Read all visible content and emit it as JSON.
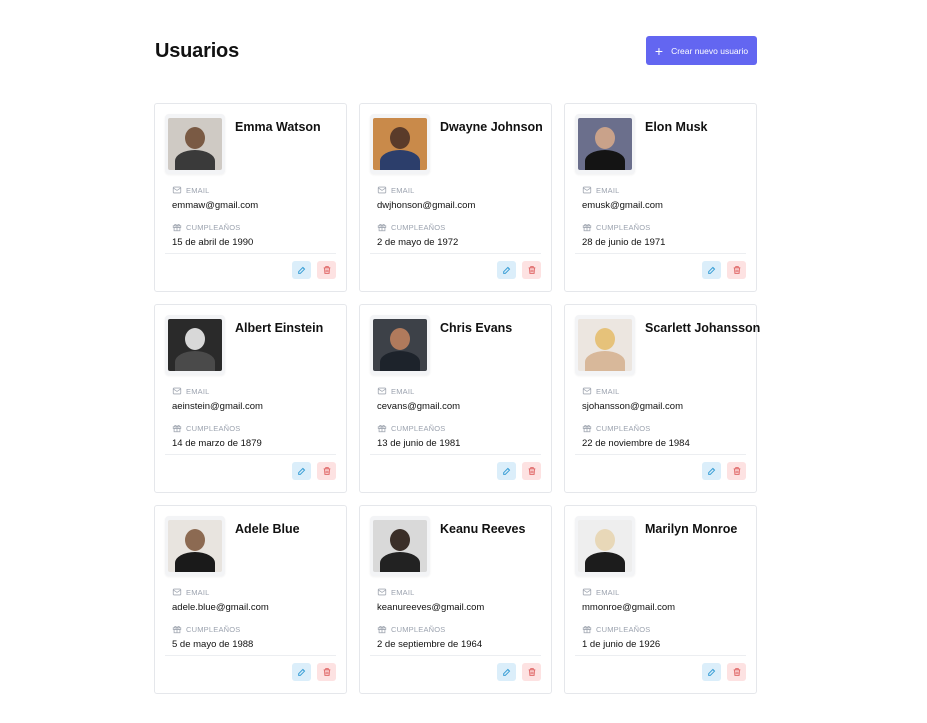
{
  "page": {
    "title": "Usuarios"
  },
  "create_button": {
    "label": "Crear nuevo usuario"
  },
  "labels": {
    "email": "EMAIL",
    "birthday": "CUMPLEAÑOS"
  },
  "colors": {
    "accent": "#6366f1",
    "edit": "#3b9fd6",
    "delete": "#e06a6a"
  },
  "users": [
    {
      "name": "Emma Watson",
      "email": "emmaw@gmail.com",
      "birthday": "15 de abril de 1990"
    },
    {
      "name": "Dwayne Johnson",
      "email": "dwjhonson@gmail.com",
      "birthday": "2 de mayo de 1972"
    },
    {
      "name": "Elon Musk",
      "email": "emusk@gmail.com",
      "birthday": "28 de junio de 1971"
    },
    {
      "name": "Albert Einstein",
      "email": "aeinstein@gmail.com",
      "birthday": "14 de marzo de 1879"
    },
    {
      "name": "Chris Evans",
      "email": "cevans@gmail.com",
      "birthday": "13 de junio de 1981"
    },
    {
      "name": "Scarlett Johansson",
      "email": "sjohansson@gmail.com",
      "birthday": "22 de noviembre de 1984"
    },
    {
      "name": "Adele Blue",
      "email": "adele.blue@gmail.com",
      "birthday": "5 de mayo de 1988"
    },
    {
      "name": "Keanu Reeves",
      "email": "keanureeves@gmail.com",
      "birthday": "2 de septiembre de 1964"
    },
    {
      "name": "Marilyn Monroe",
      "email": "mmonroe@gmail.com",
      "birthday": "1 de junio de 1926"
    }
  ]
}
